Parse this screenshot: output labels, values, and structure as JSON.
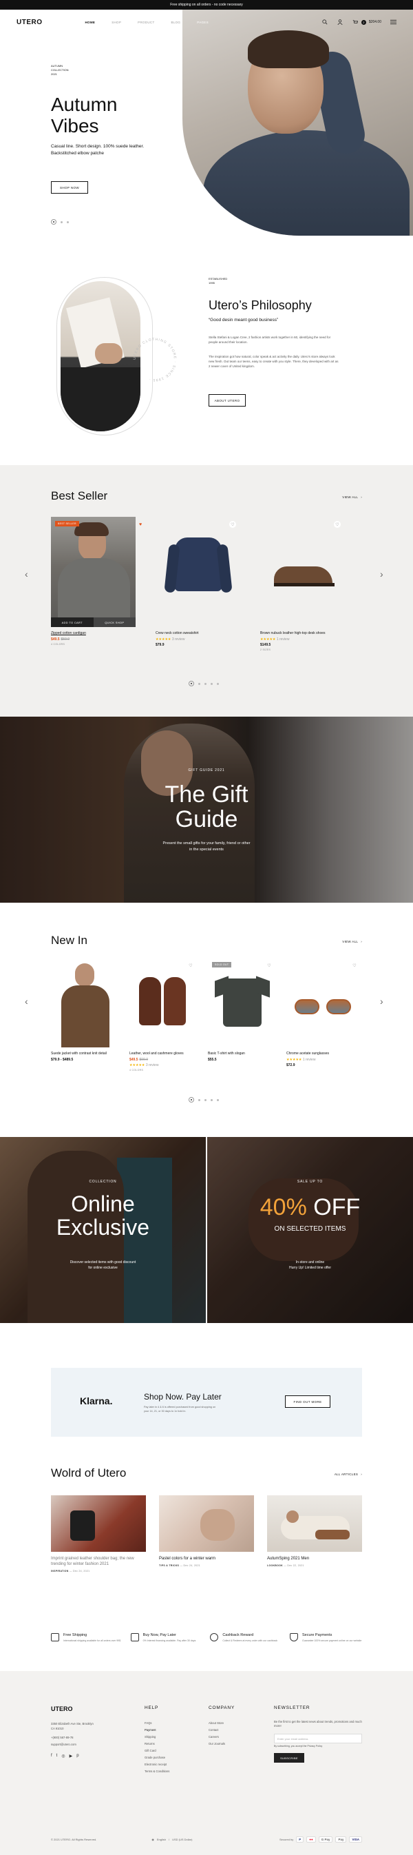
{
  "announcement": "Free shipping on all orders - no code necessary",
  "header": {
    "logo": "UTERO",
    "nav": [
      "HOME",
      "SHOP",
      "PRODUCT",
      "BLOG",
      "PAGES"
    ],
    "cart_count": "2",
    "cart_total": "$204.00"
  },
  "hero": {
    "label_lines": [
      "AUTUMN",
      "COLLECTION",
      "2021"
    ],
    "title_lines": [
      "Autumn",
      "Vibes"
    ],
    "desc_lines": [
      "Casual line. Short design. 100% suede leather.",
      "Backstitched elbow patche"
    ],
    "button": "SHOP NOW"
  },
  "philosophy": {
    "label_lines": [
      "ESTABLISHED",
      "1995"
    ],
    "title": "Utero’s Philosophy",
    "quote": "“Good desin meant good business”",
    "paragraph1": "Stella Stefani & Logan Cree, 2 fashion artists work together in 60, identifying the need for people around their location.",
    "paragraph2": "The inspiration got how natural, color speak & act activity the daily. Utero's store always look new fresh. Out team our teens, easy to create with you style. There, they developed with art as 2 newer cover of United kingdom.",
    "button": "ABOUT UTERO",
    "badge_text": "UTERO CLOTHING STORE · SINCE 1995 ·"
  },
  "best_seller": {
    "title": "Best Seller",
    "view_all": "VIEW ALL",
    "products": [
      {
        "name": "Zipped cotton cardigan",
        "price_sale": "$49.5",
        "price_old": "$59.9",
        "sub": "4 COLORS",
        "tag": "BEST SELLER",
        "add": "ADD TO CART",
        "quick": "QUICK SHOP"
      },
      {
        "name": "Crew neck cotton sweatshirt",
        "price": "$79.9",
        "stars": "★★★★★",
        "reviews": "3 review"
      },
      {
        "name": "Brown nubuck leather high-top desk shoes",
        "price": "$149.5",
        "stars": "★★★★★",
        "reviews": "1 review",
        "sub": "2 SIZES"
      }
    ]
  },
  "gift": {
    "label": "GIFT GUIDE 2021",
    "title_lines": [
      "The Gift",
      "Guide"
    ],
    "desc_lines": [
      "Present the small gifts for your family, friend or other",
      "in the special events"
    ]
  },
  "new_in": {
    "title": "New In",
    "view_all": "VIEW ALL",
    "products": [
      {
        "name": "Suede jacket with contrast knit detail",
        "price": "$79.9 - $489.5"
      },
      {
        "name": "Leather, wool and cashmere gloves",
        "price_sale": "$49.5",
        "price_old": "$99.9",
        "stars": "★★★★★",
        "reviews": "3 review",
        "sub": "4 COLORS"
      },
      {
        "name": "Basic T-shirt with slogan",
        "price": "$55.5",
        "tag": "SOLD OUT"
      },
      {
        "name": "Chrome acetate sunglasses",
        "price": "$72.9",
        "stars": "★★★★★",
        "reviews": "1 review"
      }
    ]
  },
  "promo_left": {
    "label": "COLLECTION",
    "title_lines": [
      "Online",
      "Exclusive"
    ],
    "desc_lines": [
      "Discover selected items with good discount",
      "for online exclusive"
    ]
  },
  "promo_right": {
    "label": "SALE UP TO",
    "title_accent": "40%",
    "title_rest": " OFF",
    "subtitle": "ON SELECTED ITEMS",
    "desc_lines": [
      "In-store and online",
      "Hurry Up! Limited time offer"
    ]
  },
  "klarna": {
    "logo": "Klarna.",
    "title": "Shop Now. Pay Later",
    "desc": "Pay later in 4 & 6 is offered purchased from good shopping on your 14, 21, or 30 days to 1x hold in.",
    "button": "FIND OUT MORE"
  },
  "world": {
    "title": "Wolrd of Utero",
    "all_articles": "ALL ARTICLES",
    "posts": [
      {
        "title": "Imprint grained leather shoulder bag; the new trending for winter fashion 2021",
        "tag": "INSPIRATION",
        "date": "Dec 24, 2021"
      },
      {
        "title": "Pastel colors for a winter warm",
        "tag": "TIPS & TRICKS",
        "date": "Dec 24, 2021"
      },
      {
        "title": "AutumSping 2021 Men",
        "tag": "LOOKBOOK",
        "date": "Dec 22, 2021"
      }
    ]
  },
  "features": [
    {
      "title": "Free Shipping",
      "desc": "International shipping available for all orders over 99$"
    },
    {
      "title": "Buy Now, Pay Later",
      "desc": "0% Interest financing available. Pay after 30 days"
    },
    {
      "title": "Cashback Reward",
      "desc": "Collect & Redeem at every order with our cashback"
    },
    {
      "title": "Secure Payments",
      "desc": "Guarantee 100% secure payment online on our website"
    }
  ],
  "footer": {
    "logo": "UTERO",
    "address_lines": [
      "3350 Elizabeth Ave Ste, Brooklyn",
      "CA 91010"
    ],
    "phone": "+(900) 567-89-78",
    "email": "support@utero.com",
    "social": [
      "f",
      "t",
      "◎",
      "▶",
      "p"
    ],
    "help_title": "HELP",
    "help_items": [
      "FAQs",
      "Payment",
      "Shipping",
      "Returns",
      "Gift Card",
      "Grade purchase",
      "Electronic receipt",
      "Terms & Conditions"
    ],
    "company_title": "COMPANY",
    "company_items": [
      "About Store",
      "Contact",
      "Careers",
      "Our Journals"
    ],
    "newsletter_title": "NEWSLETTER",
    "newsletter_desc": "Be the first to get the latest news about trends, promotions and much more!",
    "email_placeholder": "Enter your email address",
    "privacy": "By subscribing, you accept the Privacy Policy",
    "subscribe": "SUBSCRIBE",
    "copyright": "© 2021 UTERO. All Rights Reserved.",
    "language": "English",
    "currency": "USD (US Dollar)",
    "secured_by": "Secured by",
    "payments": [
      "P",
      "●●",
      "G Pay",
      "Pay",
      "VISA"
    ]
  }
}
